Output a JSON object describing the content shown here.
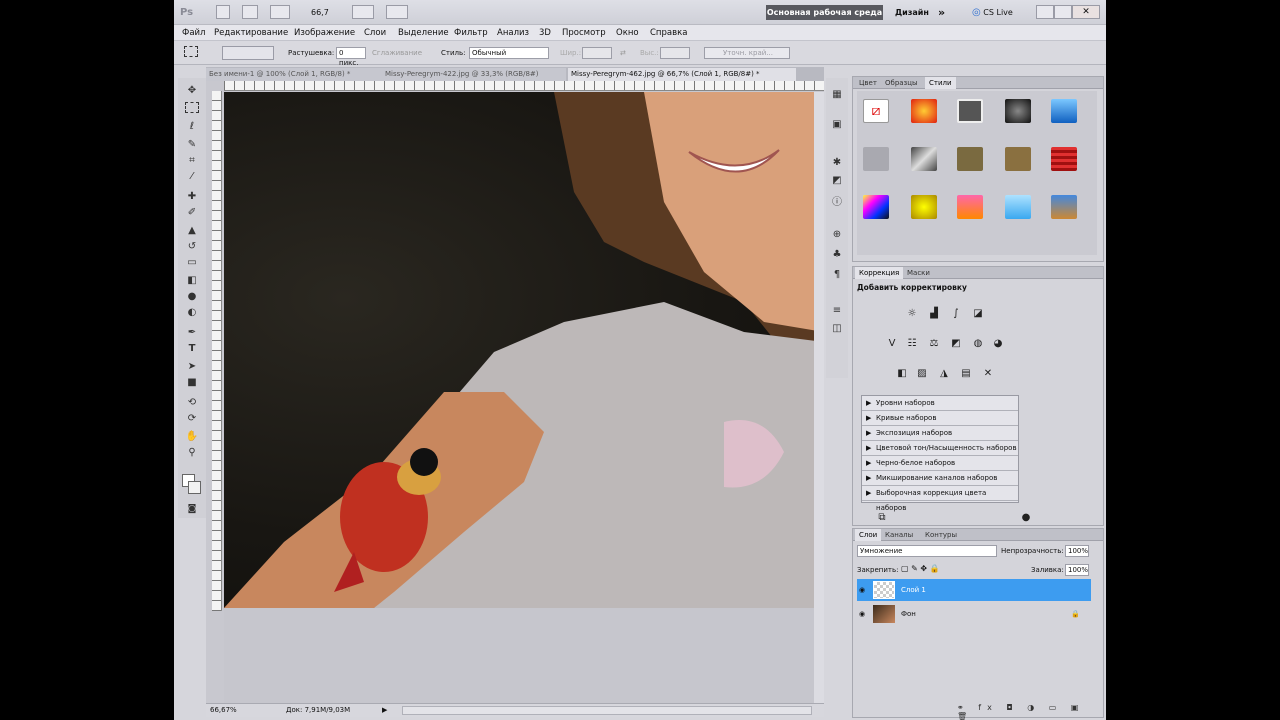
{
  "titlebar": {
    "logo": "Ps",
    "zoom": "66,7",
    "workspace_button": "Основная рабочая среда",
    "design_label": "Дизайн",
    "more": "»",
    "cslive": "CS Live"
  },
  "menu": [
    "Файл",
    "Редактирование",
    "Изображение",
    "Слои",
    "Выделение",
    "Фильтр",
    "Анализ",
    "3D",
    "Просмотр",
    "Окно",
    "Справка"
  ],
  "options": {
    "feather_label": "Растушевка:",
    "feather_value": "0 пикс.",
    "antialias_label": "Сглаживание",
    "style_label": "Стиль:",
    "style_value": "Обычный",
    "width_label": "Шир.:",
    "height_label": "Выс.:",
    "refine_button": "Уточн. край..."
  },
  "doc_tabs": [
    "Без имени-1 @ 100% (Слой 1, RGB/8) *",
    "Missy-Peregrym-422.jpg @ 33,3% (RGB/8#)",
    "Missy-Peregrym-462.jpg @ 66,7% (Слой 1, RGB/8#) *"
  ],
  "status": {
    "zoom": "66,67%",
    "doc_size": "Док: 7,91M/9,03M"
  },
  "styles_panel": {
    "tabs": [
      "Цвет",
      "Образцы",
      "Стили"
    ]
  },
  "adjust_panel": {
    "tabs": [
      "Коррекция",
      "Маски"
    ],
    "title": "Добавить корректировку",
    "presets": [
      "Уровни наборов",
      "Кривые наборов",
      "Экспозиция наборов",
      "Цветовой тон/Насыщенность наборов",
      "Черно-белое наборов",
      "Микширование каналов наборов",
      "Выборочная коррекция цвета наборов"
    ]
  },
  "layers_panel": {
    "tabs": [
      "Слои",
      "Каналы",
      "Контуры"
    ],
    "blend_mode": "Умножение",
    "opacity_label": "Непрозрачность:",
    "opacity_value": "100%",
    "lock_label": "Закрепить:",
    "fill_label": "Заливка:",
    "fill_value": "100%",
    "layers": [
      "Слой 1",
      "Фон"
    ]
  },
  "colors": {
    "accent": "#3d9cf0",
    "workspace_button_bg": "#58595f"
  }
}
